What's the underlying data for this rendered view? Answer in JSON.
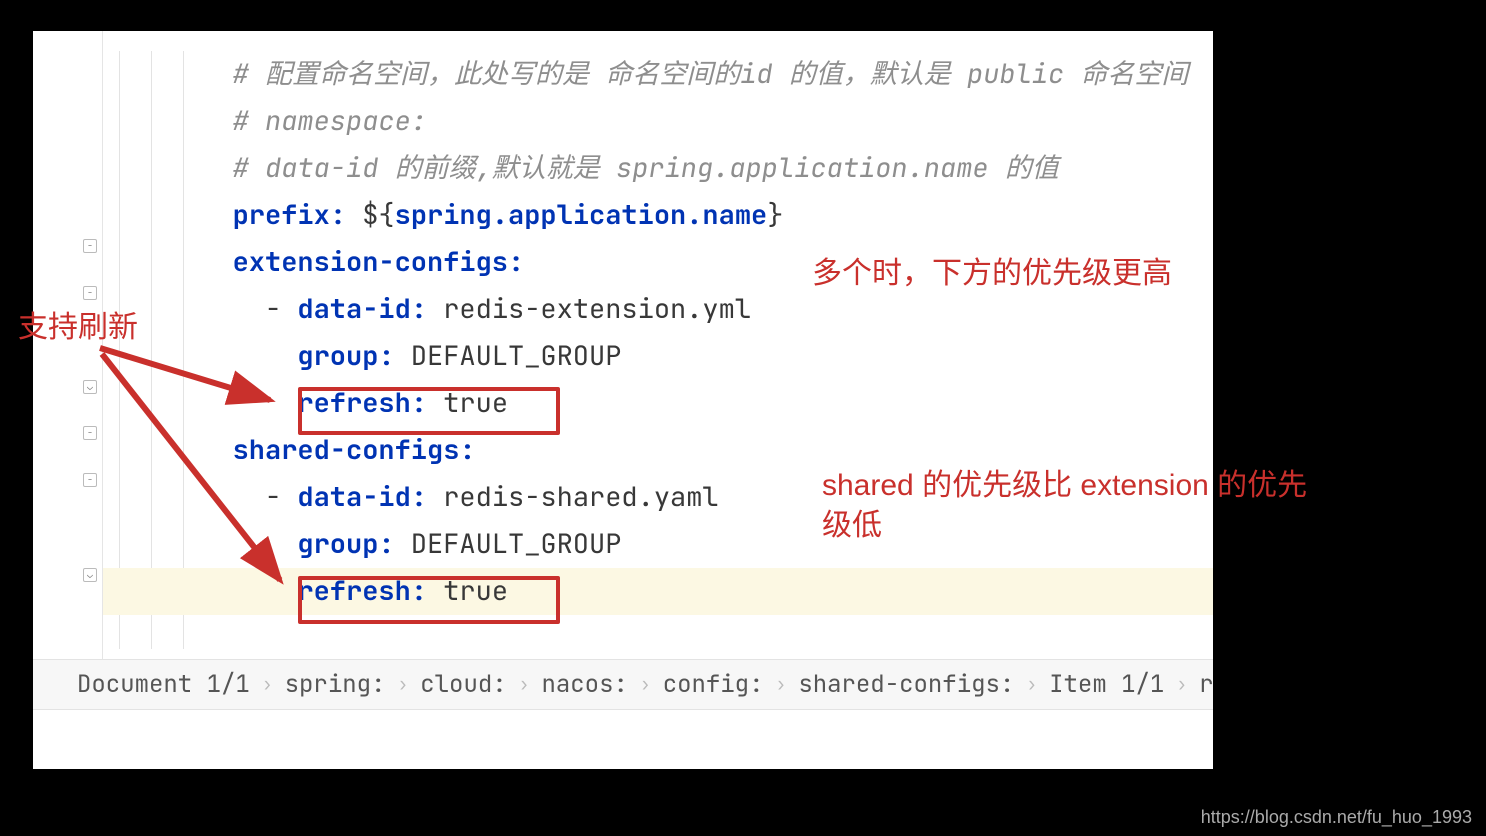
{
  "code": {
    "comment1": "# 配置命名空间，此处写的是 命名空间的id 的值，默认是 public 命名空间",
    "comment2": "# namespace:",
    "comment3": "# data-id 的前缀,默认就是 spring.application.name 的值",
    "prefix_key": "prefix",
    "prefix_val": "${spring.application.name}",
    "ext_key": "extension-configs",
    "ext_dataid_key": "data-id",
    "ext_dataid_val": "redis-extension.yml",
    "ext_group_key": "group",
    "ext_group_val": "DEFAULT_GROUP",
    "ext_refresh_key": "refresh",
    "ext_refresh_val": "true",
    "shared_key": "shared-configs",
    "sh_dataid_key": "data-id",
    "sh_dataid_val": "redis-shared.yaml",
    "sh_group_key": "group",
    "sh_group_val": "DEFAULT_GROUP",
    "sh_refresh_key": "refresh",
    "sh_refresh_val": "true"
  },
  "annotations": {
    "left": "支持刷新",
    "right_top": "多个时，下方的优先级更高",
    "right_bottom": "shared 的优先级比 extension 的优先级低"
  },
  "breadcrumb": {
    "doc": "Document 1/1",
    "p1": "spring:",
    "p2": "cloud:",
    "p3": "nacos:",
    "p4": "config:",
    "p5": "shared-configs:",
    "p6": "Item 1/1",
    "p7": "refresh:"
  },
  "watermark": "https://blog.csdn.net/fu_huo_1993",
  "colors": {
    "key": "#0033b3",
    "comment": "#8e8e8e",
    "annotation": "#c9302c"
  }
}
